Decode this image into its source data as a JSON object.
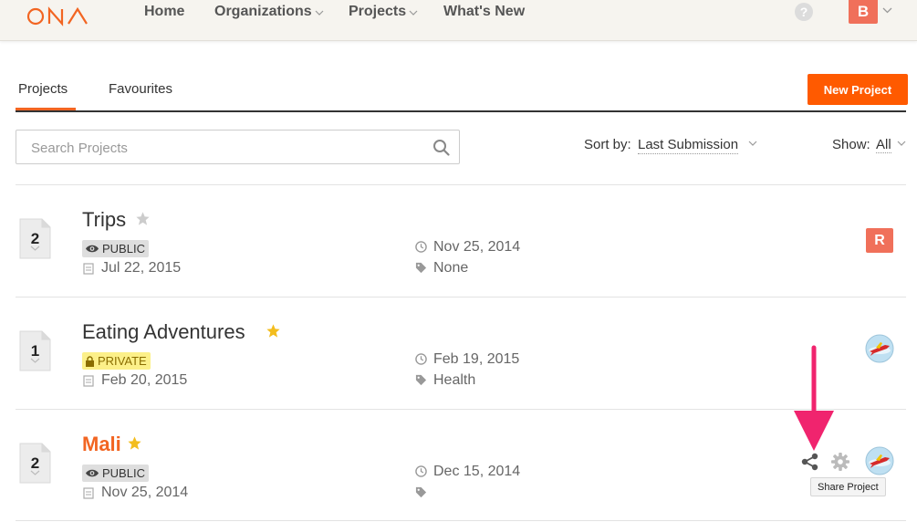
{
  "nav": {
    "logo_text": "ONA",
    "items": [
      {
        "label": "Home",
        "has_dropdown": false
      },
      {
        "label": "Organizations",
        "has_dropdown": true
      },
      {
        "label": "Projects",
        "has_dropdown": true
      },
      {
        "label": "What's New",
        "has_dropdown": false
      }
    ],
    "help_icon": "question-circle-icon",
    "user_initial": "B"
  },
  "tabs": [
    {
      "label": "Projects",
      "active": true
    },
    {
      "label": "Favourites",
      "active": false
    }
  ],
  "new_project_label": "New Project",
  "search": {
    "placeholder": "Search Projects",
    "value": ""
  },
  "sort": {
    "label": "Sort by:",
    "value": "Last Submission"
  },
  "show": {
    "label": "Show:",
    "value": "All"
  },
  "projects": [
    {
      "count": "2",
      "title": "Trips",
      "starred": false,
      "visibility": "PUBLIC",
      "created": "Jul 22, 2015",
      "last_submission": "Nov 25, 2014",
      "tags": "None",
      "owner_initial": "R",
      "owner_avatar": "initial"
    },
    {
      "count": "1",
      "title": "Eating Adventures",
      "starred": true,
      "visibility": "PRIVATE",
      "created": "Feb 20, 2015",
      "last_submission": "Feb 19, 2015",
      "tags": "Health",
      "owner_avatar": "plane-image"
    },
    {
      "count": "2",
      "title": "Mali",
      "starred": true,
      "highlighted": true,
      "visibility": "PUBLIC",
      "created": "Nov 25, 2014",
      "last_submission": "Dec 15, 2014",
      "tags": "",
      "owner_avatar": "plane-image",
      "actions": [
        "share-icon",
        "gear-icon"
      ]
    }
  ],
  "tooltip": "Share Project",
  "colors": {
    "accent": "#f26522",
    "button": "#ff5a00",
    "annotation_arrow": "#f0246e",
    "star_on": "#f3bd1d",
    "star_off": "#cccccc"
  }
}
